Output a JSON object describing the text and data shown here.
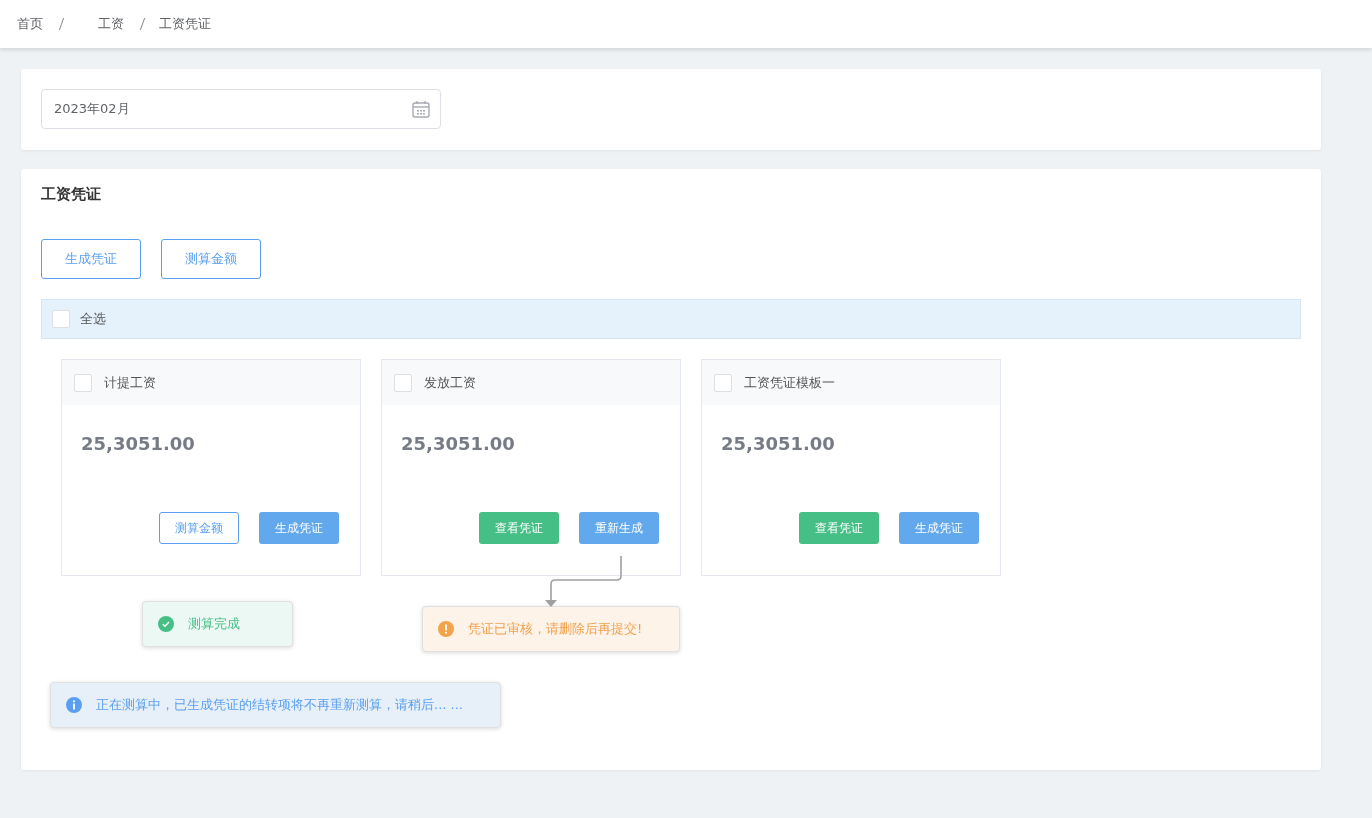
{
  "breadcrumb": [
    {
      "label": "首页"
    },
    {
      "label": "工资"
    },
    {
      "label": "工资凭证"
    }
  ],
  "date_picker": {
    "value": "2023年02月"
  },
  "panel": {
    "title": "工资凭证",
    "actions": [
      {
        "label": "生成凭证"
      },
      {
        "label": "测算金额"
      }
    ],
    "select_all": {
      "label": "全选",
      "checked": false
    },
    "cards": [
      {
        "title": "计提工资",
        "checked": false,
        "amount": "25,3051.00",
        "buttons": [
          {
            "label": "测算金额",
            "kind": "outline"
          },
          {
            "label": "生成凭证",
            "kind": "primary"
          }
        ]
      },
      {
        "title": "发放工资",
        "checked": false,
        "amount": "25,3051.00",
        "buttons": [
          {
            "label": "查看凭证",
            "kind": "success"
          },
          {
            "label": "重新生成",
            "kind": "primary"
          }
        ]
      },
      {
        "title": "工资凭证模板一",
        "checked": false,
        "amount": "25,3051.00",
        "buttons": [
          {
            "label": "查看凭证",
            "kind": "success"
          },
          {
            "label": "生成凭证",
            "kind": "primary"
          }
        ]
      }
    ]
  },
  "messages": [
    {
      "kind": "success",
      "text": "测算完成"
    },
    {
      "kind": "warning",
      "text": "凭证已审核，请删除后再提交!"
    },
    {
      "kind": "info",
      "text": "正在测算中，已生成凭证的结转项将不再重新测算，请稍后... ..."
    }
  ]
}
